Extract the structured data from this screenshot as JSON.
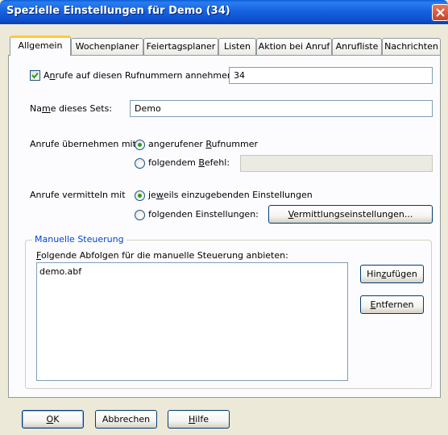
{
  "window": {
    "title": "Spezielle Einstellungen für Demo (34)"
  },
  "tabs": [
    {
      "label": "Allgemein",
      "active": true
    },
    {
      "label": "Wochenplaner"
    },
    {
      "label": "Feiertagsplaner"
    },
    {
      "label": "Listen"
    },
    {
      "label": "Aktion bei Anruf"
    },
    {
      "label": "Anrufliste"
    },
    {
      "label": "Nachrichten"
    }
  ],
  "general": {
    "accept_calls": {
      "label_pre": "A",
      "label_acc": "n",
      "label_post": "rufe auf diesen Rufnummern annehmen:",
      "checked": true,
      "value": "34"
    },
    "set_name": {
      "label_pre": "Na",
      "label_acc": "m",
      "label_post": "e dieses Sets:",
      "value": "Demo"
    },
    "take_calls": {
      "label": "Anrufe übernehmen mit",
      "option1": {
        "pre": "angerufener ",
        "acc": "R",
        "post": "ufnummer",
        "selected": true
      },
      "option2": {
        "pre": "folgendem ",
        "acc": "B",
        "post": "efehl:",
        "selected": false
      },
      "command_value": ""
    },
    "forward_calls": {
      "label": "Anrufe vermitteln mit",
      "option1": {
        "pre": "je",
        "acc": "w",
        "post": "eils einzugebenden Einstellungen",
        "selected": true
      },
      "option2": {
        "pre": "folgenden Einstellungen:",
        "selected": false
      },
      "settings_button": {
        "acc": "V",
        "post": "ermittlungseinstellungen..."
      }
    },
    "manual": {
      "group_label": "Manuelle Steuerung",
      "list_label_acc": "F",
      "list_label_post": "olgende Abfolgen für die manuelle Steuerung anbieten:",
      "items": [
        "demo.abf"
      ],
      "add_button": {
        "pre": "Hin",
        "acc": "z",
        "post": "ufügen"
      },
      "remove_button": {
        "acc": "E",
        "post": "ntfernen"
      }
    }
  },
  "footer": {
    "ok": {
      "acc": "O",
      "post": "K"
    },
    "cancel": {
      "label": "Abbrechen"
    },
    "help": {
      "acc": "H",
      "post": "ilfe"
    }
  },
  "colors": {
    "titlebar": "#0A5FD8",
    "dialog_bg": "#ECE9D8",
    "group_label": "#0046D5",
    "radio_dot": "#21A121",
    "active_tab_accent": "#FFC83C"
  }
}
